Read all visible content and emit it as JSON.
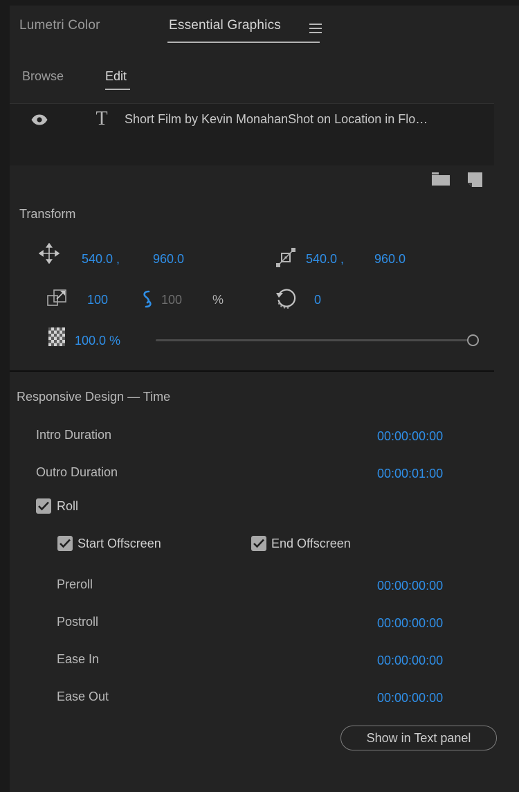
{
  "panel": {
    "tabs": [
      {
        "label": "Lumetri Color",
        "active": false
      },
      {
        "label": "Essential Graphics",
        "active": true
      }
    ],
    "menu_icon": "hamburger-menu-icon",
    "subtabs": [
      {
        "label": "Browse",
        "active": false
      },
      {
        "label": "Edit",
        "active": true
      }
    ]
  },
  "layers": {
    "items": [
      {
        "visibility_icon": "eye-icon",
        "type_icon": "text-layer-icon",
        "name": "Short Film by Kevin MonahanShot on Location in Flo…"
      }
    ],
    "toolbar": {
      "folder_icon": "new-folder-icon",
      "new_layer_icon": "new-layer-icon"
    }
  },
  "transform": {
    "title": "Transform",
    "position": {
      "icon": "position-move-icon",
      "x": "540.0 ,",
      "y": "960.0"
    },
    "anchor_point": {
      "icon": "anchor-point-icon",
      "x": "540.0 ,",
      "y": "960.0"
    },
    "scale": {
      "icon": "scale-icon",
      "value": "100",
      "link_icon": "link-chain-icon",
      "linked_value": "100",
      "unit": "%"
    },
    "rotation": {
      "icon": "rotation-icon",
      "value": "0"
    },
    "opacity": {
      "icon": "opacity-checkerboard-icon",
      "value": "100.0 %",
      "slider_percent": 100
    }
  },
  "responsive_design": {
    "title": "Responsive Design — Time",
    "rows": [
      {
        "label": "Intro Duration",
        "value": "00:00:00:00"
      },
      {
        "label": "Outro Duration",
        "value": "00:00:01:00"
      }
    ],
    "roll": {
      "label": "Roll",
      "checked": true
    },
    "offscreen": [
      {
        "label": "Start Offscreen",
        "checked": true
      },
      {
        "label": "End Offscreen",
        "checked": true
      }
    ],
    "roll_rows": [
      {
        "label": "Preroll",
        "value": "00:00:00:00"
      },
      {
        "label": "Postroll",
        "value": "00:00:00:00"
      },
      {
        "label": "Ease In",
        "value": "00:00:00:00"
      },
      {
        "label": "Ease Out",
        "value": "00:00:00:00"
      }
    ]
  },
  "actions": {
    "show_in_text_panel": "Show in Text panel"
  },
  "colors": {
    "accent_blue": "#2f8fe8",
    "panel_bg": "#232323",
    "list_bg": "#1e1e1e",
    "text": "#b9b9b9"
  }
}
